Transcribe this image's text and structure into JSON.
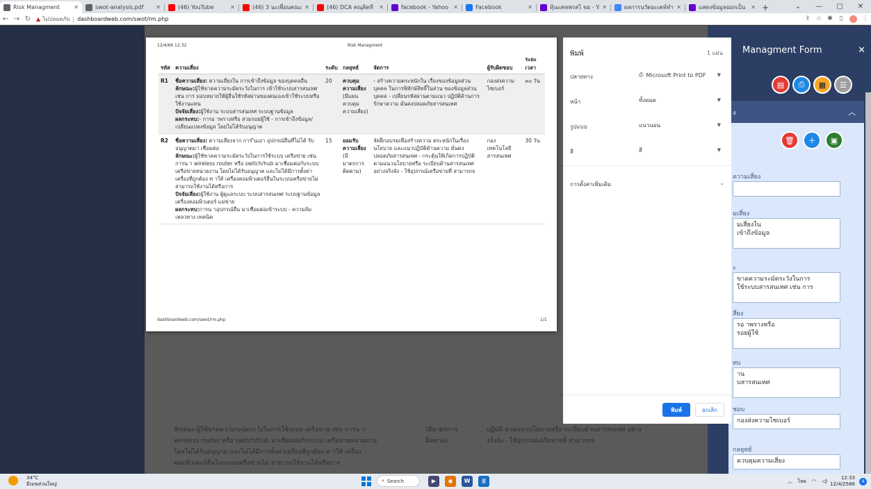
{
  "browser": {
    "tabs": [
      {
        "label": "Risk Managment",
        "active": true,
        "fav_color": "#5f6368"
      },
      {
        "label": "swot-analysis.pdf",
        "active": false,
        "fav_color": "#5f6368"
      },
      {
        "label": "(46) YouTube",
        "active": false,
        "fav_color": "#ff0000"
      },
      {
        "label": "(46) 3 นะเพื่อนคณะบ",
        "active": false,
        "fav_color": "#ff0000"
      },
      {
        "label": "(46) DCA คณุลิตที",
        "active": false,
        "fav_color": "#ff0000"
      },
      {
        "label": "facebook - Yahoo",
        "active": false,
        "fav_color": "#6001d2"
      },
      {
        "label": "Facebook",
        "active": false,
        "fav_color": "#1877f2"
      },
      {
        "label": "หุ้นแคทพรสโ ขอ - Yah",
        "active": false,
        "fav_color": "#6001d2"
      },
      {
        "label": "ผลการนวัตอะเคท์ทำะ",
        "active": false,
        "fav_color": "#4285f4"
      },
      {
        "label": "แสดงข้อมูลออกเป็น",
        "active": false,
        "fav_color": "#6001d2"
      }
    ],
    "newtab_symbol": "+",
    "insecure_label": "ไม่ปลอดภัย",
    "url": "dashboardweb.com/swot/rm.php"
  },
  "sheet": {
    "header_date": "12/4/66 12:32",
    "header_title": "Risk Managment",
    "footer_url": "dashboardweb.com/swot/rm.php",
    "footer_page": "1/1",
    "columns": [
      "รหัส",
      "ความเสี่ยง",
      "ระดับ",
      "กลยุทธ์",
      "จัดการ",
      "ผู้รับผิดชอบ",
      "ระยะ เวลา"
    ],
    "rows": [
      {
        "code": "R1",
        "risk_name_label": "ชื่อความเสี่ยง:",
        "risk_name": "ความเสี่ยงใน การเข้าถึงข้อมูล ของบุคคลอื่น",
        "nature_label": "ลักษณะ:",
        "nature": "ผู้ใช้ขาดความระมัดระวังในการ เข้าใช้ระบบสารสนเทศ เช่น การ มอบหมายให้ผู้อื่นใช้รหัสผ่านของตนเองเข้าใช้ระบบหรือใช้งานแทน",
        "factor_label": "ปัจจัยเสี่ยง:",
        "factor": "ผู้ใช้งาน ระบบสารสนเทศ ระบบฐานข้อมูล",
        "impact_label": "ผลกระทบ:",
        "impact": "- การอ าพรางหรือ สวมรอยผู้ใช้ - การเข้าถึงข้อมูล/ เปลี่ยนแปลงข้อมูล โดยไม่ได้รับอนุญาต",
        "level": "20",
        "strategy": "ควบคุมความเสี่ยง",
        "strategy_note": "(มีแผนควบคุมความเสี่ยง)",
        "manage": "- สร้างความตระหนักใน เรื่องของข้อมูลส่วนบุคคล ในการพิทักษ์สิทธิ์ในส่วน ของข้อมูลส่วนบุคคล - เปลี่ยนรหัสผ่านตามแนว ปฏิบัติด้านการรักษาความ มั่นคงปลอดภัยสารสนเทศ",
        "owner": "กองส่งความไซเบอร์",
        "duration": "๓๐ วัน"
      },
      {
        "code": "R2",
        "risk_name_label": "ชื่อความเสี่ยง:",
        "risk_name": "ความเสี่ยงจาก การ ีนเอา อุปกรณ์อื่นที่ไม่ได้ รับอนุญาตมา เชื่อมต่อ",
        "nature_label": "ลักษณะ:",
        "nature": "ผู้ใช้ขาดความระมัดระวังในการใช้ระบบ เครือข่าย เช่น การน า wireless router หรือ switch/hub มาเชื่อมต่อกับระบบ เครือข่ายหน่วยงาน โดยไม่ได้รับอนุญาต และไม่ได้มีการตั้งค่าเครื่องที่ถูกต้อง ท าให้ เครื่องคอมพิวเตอร์อื่นในระบบเครือข่ายไม่ สามารถใช้งานได้หรือการ",
        "factor_label": "ปัจจัยเสี่ยง:",
        "factor": "ผู้ใช้งาน ผู้ดูแลระบบ ระบบสารสนเทศ ระบบฐานข้อมูล เครื่องคอมพิวเตอร์ แม่ข่าย",
        "impact_label": "ผลกระทบ:",
        "impact": "การน าอุปกรณ์อื่น มาเชื่อมต่อเข้าระบบ - ความล้มเหลวทาง เทคนิค",
        "level": "15",
        "strategy": "ยอมรับความเสี่ยง",
        "strategy_note": "(มีมาตรการติดตาม)",
        "manage": "จัดฝึกอบรมเพื่อสร้างความ ตระหนักในเรื่องนโยบาย และแนวปฏิบัติด้านความ มั่นคงปลอดภัยสารสนเทศ - กระตุ้นให้เกิดการปฏิบัติ ตามแนวนโยบายหรือ ระเบียบด้านสารสนเทศ อย่างจริงจัง - ใช้อุปกรณ์เครือข่ายที่ สามารถจ",
        "owner": "กอง เทคโนโลยี สารสนเทศ",
        "duration": "30 วัน"
      }
    ]
  },
  "print": {
    "title": "พิมพ์",
    "sheet_count": "1 แผ่น",
    "destination_label": "ปลายทาง",
    "destination_value": "Microsoft Print to PDF",
    "pages_label": "หน้า",
    "pages_value": "ทั้งหมด",
    "layout_label": "รูปแบบ",
    "layout_value": "แนวนอน",
    "color_label": "สี",
    "color_value": "สี",
    "more_settings": "การตั้งค่าเพิ่มเติม",
    "print_button": "พิมพ์",
    "cancel_button": "ยกเลิก"
  },
  "form": {
    "title": "Managment Form",
    "fields": [
      {
        "label": "ความเสี่ยง",
        "value": ""
      },
      {
        "label": "มเสี่ยง",
        "value": "มเสี่ยงใน\nเข้าถึงข้อมูล"
      },
      {
        "label": "ะ",
        "value": "ขาดความระมัดระวังในการ\nใช้ระบบสารสนเทศ เช่น การ"
      },
      {
        "label": "สี่ยง",
        "value": "รอ าพรางหรือ\nรอยผู้ใช้"
      },
      {
        "label": "ทบ",
        "value": "าน\nบสารสนเทศ"
      },
      {
        "label": "ชอบ",
        "value": "กองส่งความไซเบอร์"
      },
      {
        "label": "กลยุทธ์",
        "value": "ควบคุมความเสี่ยง"
      }
    ]
  },
  "background_text": {
    "line1": "ลักษณะ:ผู้ใช้ขาดความระมัดระวังในการใช้ระบบ เครือข่าย เช่น การน า",
    "line2": "wireless router หรือ switch/hub มาเชื่อมต่อกับระบบ เครือข่ายหน่วยงาน",
    "line3": "โดยไม่ได้รับอนุญาต และไม่ได้มีการตั้งค่าเครื่องที่ถูกต้อง ท าให้ เครื่อง",
    "line4": "คอมพิวเตอร์อื่นในระบบเครือข่ายไม่ สามารถใช้งานได้หรือการ",
    "mid1": "(มีมาตรการ",
    "mid2": "ติดตาม)",
    "right1": "ปฏิบัติ ตามแนวนโยบายหรือ ระเบียบด้านสารสนเทศ อย่าง",
    "right2": "จริงจัง - ใช้อุปกรณ์เครือข่ายที่ สามารถจ"
  },
  "taskbar": {
    "temp": "34°C",
    "weather_desc": "มีเมฆส่วนใหญ่",
    "search": "Search",
    "lang": "ไทย",
    "time": "12:33",
    "date": "12/4/2566",
    "notif_count": "4"
  }
}
